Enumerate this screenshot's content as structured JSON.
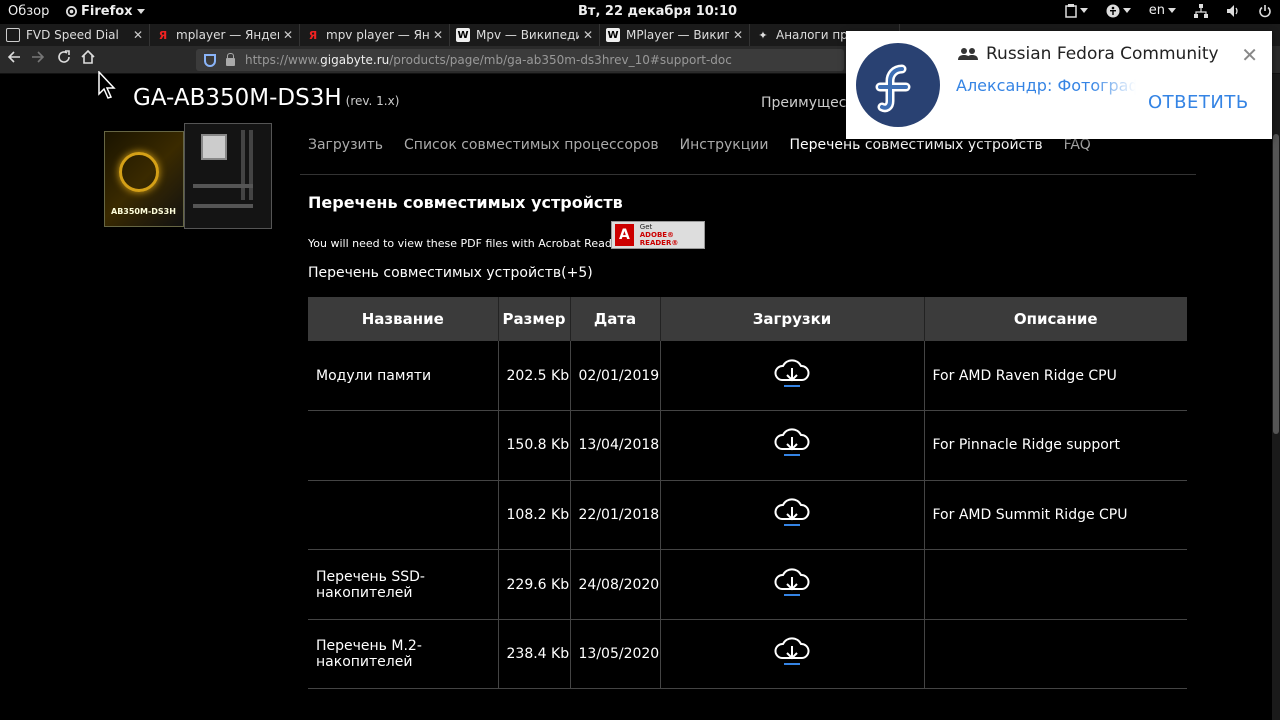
{
  "topbar": {
    "overview": "Обзор",
    "app": "Firefox",
    "clock": "Вт, 22 декабря  10:10",
    "lang": "en"
  },
  "tabs": [
    {
      "title": "FVD Speed Dial",
      "icon": "speed-dial-icon"
    },
    {
      "title": "mplayer — Яндекс",
      "icon": "yandex-icon"
    },
    {
      "title": "mpv player — Янд",
      "icon": "yandex-icon"
    },
    {
      "title": "Mpv — Википедия",
      "icon": "wikipedia-icon"
    },
    {
      "title": "MPlayer — Википе",
      "icon": "wikipedia-icon"
    },
    {
      "title": "Аналоги програм",
      "icon": "star-icon"
    }
  ],
  "url": {
    "prefix": "https://www.",
    "domain": "gigabyte.ru",
    "path": "/products/page/mb/ga-ab350m-ds3hrev_10#support-doc"
  },
  "product": {
    "title": "GA-AB350M-DS3H",
    "rev": "(rev. 1.x)",
    "advantages": "Преимущест",
    "box_label": "AB350M-DS3H"
  },
  "subnav": [
    "Загрузить",
    "Список совместимых процессоров",
    "Инструкции",
    "Перечень совместимых устройств",
    "FAQ"
  ],
  "section": {
    "title": "Перечень совместимых устройств",
    "pdf_note": "You will need to view these PDF files with Acrobat Reader.",
    "adobe_get": "Get",
    "adobe_reader": "ADOBE® READER®",
    "list_count": "Перечень совместимых устройств(+5)"
  },
  "table": {
    "headers": [
      "Название",
      "Размер",
      "Дата",
      "Загрузки",
      "Описание"
    ],
    "rows": [
      {
        "name": "Модули памяти",
        "size": "202.5 Kb",
        "date": "02/01/2019",
        "desc": "For AMD Raven Ridge CPU"
      },
      {
        "name": "",
        "size": "150.8 Kb",
        "date": "13/04/2018",
        "desc": "For Pinnacle Ridge support"
      },
      {
        "name": "",
        "size": "108.2 Kb",
        "date": "22/01/2018",
        "desc": "For AMD Summit Ridge CPU"
      },
      {
        "name": "Перечень SSD-накопителей",
        "size": "229.6 Kb",
        "date": "24/08/2020",
        "desc": ""
      },
      {
        "name": "Перечень M.2-накопителей",
        "size": "238.4 Kb",
        "date": "13/05/2020",
        "desc": ""
      }
    ]
  },
  "notification": {
    "title": "Russian Fedora Community",
    "body": "Александр: Фотографии",
    "reply": "ОТВЕТИТЬ"
  },
  "colors": {
    "accent": "#3584e4",
    "fedora": "#294172",
    "header_bg": "#3b3b3b"
  }
}
